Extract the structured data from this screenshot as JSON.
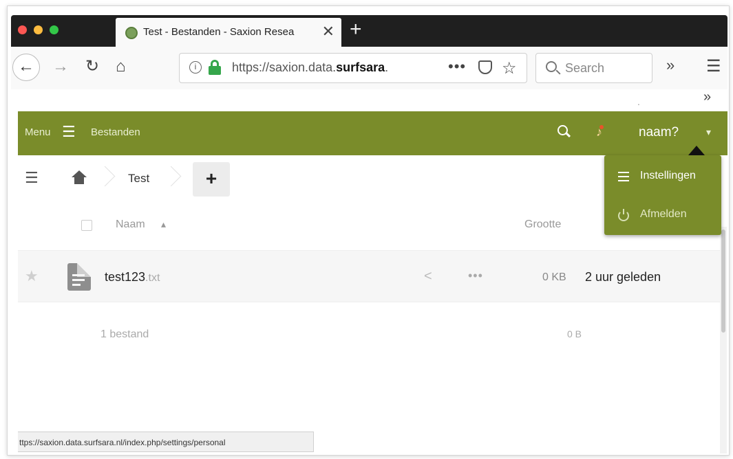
{
  "browser": {
    "tab_title": "Test - Bestanden - Saxion Resea",
    "tab_close": "✕",
    "new_tab": "+",
    "url_prefix": "https://saxion.data.",
    "url_host": "surfsara",
    "url_suffix": ".",
    "url_more": "•••",
    "search_placeholder": "Search",
    "overflow": "»",
    "menu": "☰",
    "bookmarks_overflow": "»",
    "dot": "."
  },
  "app": {
    "menu_label": "Menu",
    "menu_icon": "☰",
    "title": "Bestanden",
    "user_name": "naam?",
    "user_caret": "▾"
  },
  "toolbar": {
    "breadcrumb_folder": "Test",
    "new_label": "+"
  },
  "columns": {
    "name": "Naam",
    "sort_indicator": "▴",
    "size": "Grootte"
  },
  "files": [
    {
      "name": "test123",
      "extension": ".txt",
      "size": "0 KB",
      "modified": "2 uur geleden"
    }
  ],
  "summary": {
    "count": "1 bestand",
    "total_size": "0 B"
  },
  "statusbar": {
    "url": "ttps://saxion.data.surfsara.nl/index.php/settings/personal"
  },
  "user_menu": {
    "items": [
      {
        "label": "Instellingen",
        "icon": "settings-list-icon"
      },
      {
        "label": "Afmelden",
        "icon": "power-icon"
      }
    ]
  },
  "colors": {
    "header_green": "#7a8c2a",
    "lock_green": "#35a64b"
  }
}
